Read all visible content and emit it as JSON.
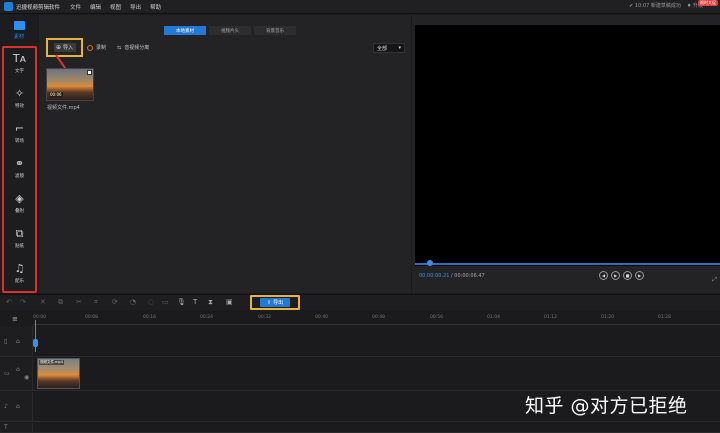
{
  "titlebar": {
    "app_title": "迅捷视频剪辑软件",
    "menu": [
      "文件",
      "编辑",
      "视图",
      "导出",
      "帮助"
    ],
    "status_text": "10:07 新建草稿成功",
    "badge": "限时大促",
    "upgrade": "升级"
  },
  "sidebar": {
    "top_label": "素材",
    "items": [
      {
        "label": "文字",
        "icon": "text-icon"
      },
      {
        "label": "特效",
        "icon": "sparkle-icon"
      },
      {
        "label": "转场",
        "icon": "transition-icon"
      },
      {
        "label": "滤镜",
        "icon": "filter-icon"
      },
      {
        "label": "叠附",
        "icon": "layers-icon"
      },
      {
        "label": "贴纸",
        "icon": "sticker-icon"
      },
      {
        "label": "配乐",
        "icon": "music-icon"
      }
    ]
  },
  "media": {
    "tabs": [
      "本地素材",
      "视频片头",
      "背景音乐"
    ],
    "import_label": "导入",
    "record_label": "录制",
    "split_label": "音视频分离",
    "filter_value": "全部",
    "thumb_duration": "00:06",
    "thumb_name": "视频文件.mp4"
  },
  "preview": {
    "current_time": "00:00:00.21",
    "total_time": "/ 00:00:06.47"
  },
  "toolbar": {
    "export_label": "导出"
  },
  "timeline": {
    "ticks": [
      "00:00",
      "00:08",
      "00:16",
      "00:24",
      "00:32",
      "00:40",
      "00:48",
      "00:56",
      "01:04",
      "01:12",
      "01:20",
      "01:28"
    ],
    "clip_name": "视频文件.mp4"
  },
  "watermark": "知乎 @对方已拒绝",
  "colors": {
    "accent": "#2379d6",
    "highlight": "#e3b441",
    "sidebar_border": "#d93030"
  }
}
